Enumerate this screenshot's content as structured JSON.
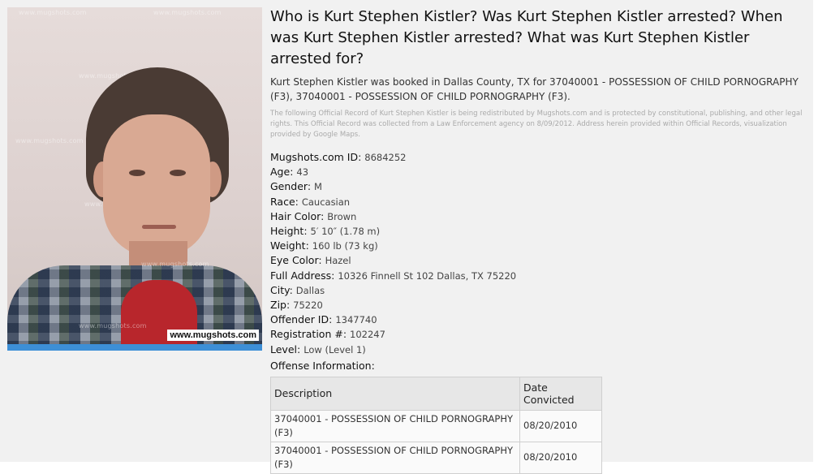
{
  "photo": {
    "watermark": "www.mugshots.com",
    "stamp": "www.mugshots.com"
  },
  "heading": "Who is Kurt Stephen Kistler? Was Kurt Stephen Kistler arrested? When was Kurt Stephen Kistler arrested? What was Kurt Stephen Kistler arrested for?",
  "booked_text": "Kurt Stephen Kistler was booked in Dallas County, TX for 37040001 - POSSESSION OF CHILD PORNOGRAPHY (F3), 37040001 - POSSESSION OF CHILD PORNOGRAPHY (F3).",
  "legal_text": "The following Official Record of Kurt Stephen Kistler is being redistributed by Mugshots.com and is protected by constitutional, publishing, and other legal rights. This Official Record was collected from a Law Enforcement agency on 8/09/2012. Address herein provided within Official Records, visualization provided by Google Maps.",
  "fields": [
    {
      "label": "Mugshots.com ID",
      "value": "8684252"
    },
    {
      "label": "Age",
      "value": "43"
    },
    {
      "label": "Gender",
      "value": "M"
    },
    {
      "label": "Race",
      "value": "Caucasian"
    },
    {
      "label": "Hair Color",
      "value": "Brown"
    },
    {
      "label": "Height",
      "value": "5′ 10″ (1.78 m)"
    },
    {
      "label": "Weight",
      "value": "160 lb (73 kg)"
    },
    {
      "label": "Eye Color",
      "value": "Hazel"
    },
    {
      "label": "Full Address",
      "value": "10326 Finnell St 102 Dallas, TX 75220"
    },
    {
      "label": "City",
      "value": "Dallas"
    },
    {
      "label": "Zip",
      "value": "75220"
    },
    {
      "label": "Offender ID",
      "value": "1347740"
    },
    {
      "label": "Registration #",
      "value": "102247"
    },
    {
      "label": "Level",
      "value": "Low (Level 1)"
    }
  ],
  "offense": {
    "title": "Offense Information:",
    "columns": [
      "Description",
      "Date Convicted"
    ],
    "rows": [
      {
        "description": "37040001 - POSSESSION OF CHILD PORNOGRAPHY (F3)",
        "date": "08/20/2010"
      },
      {
        "description": "37040001 - POSSESSION OF CHILD PORNOGRAPHY (F3)",
        "date": "08/20/2010"
      }
    ]
  }
}
